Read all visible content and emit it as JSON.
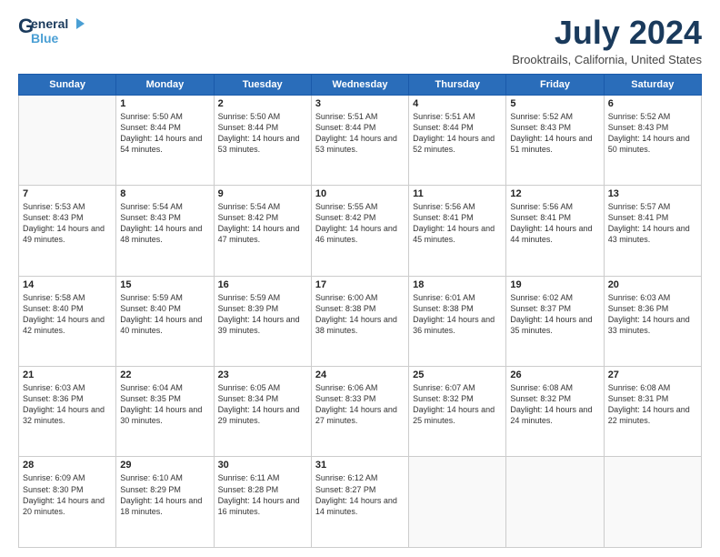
{
  "logo": {
    "g": "G",
    "eneral": "eneral",
    "blue": "Blue"
  },
  "title": "July 2024",
  "subtitle": "Brooktrails, California, United States",
  "days": [
    "Sunday",
    "Monday",
    "Tuesday",
    "Wednesday",
    "Thursday",
    "Friday",
    "Saturday"
  ],
  "weeks": [
    [
      {
        "num": "",
        "sunrise": "",
        "sunset": "",
        "daylight": ""
      },
      {
        "num": "1",
        "sunrise": "Sunrise: 5:50 AM",
        "sunset": "Sunset: 8:44 PM",
        "daylight": "Daylight: 14 hours and 54 minutes."
      },
      {
        "num": "2",
        "sunrise": "Sunrise: 5:50 AM",
        "sunset": "Sunset: 8:44 PM",
        "daylight": "Daylight: 14 hours and 53 minutes."
      },
      {
        "num": "3",
        "sunrise": "Sunrise: 5:51 AM",
        "sunset": "Sunset: 8:44 PM",
        "daylight": "Daylight: 14 hours and 53 minutes."
      },
      {
        "num": "4",
        "sunrise": "Sunrise: 5:51 AM",
        "sunset": "Sunset: 8:44 PM",
        "daylight": "Daylight: 14 hours and 52 minutes."
      },
      {
        "num": "5",
        "sunrise": "Sunrise: 5:52 AM",
        "sunset": "Sunset: 8:43 PM",
        "daylight": "Daylight: 14 hours and 51 minutes."
      },
      {
        "num": "6",
        "sunrise": "Sunrise: 5:52 AM",
        "sunset": "Sunset: 8:43 PM",
        "daylight": "Daylight: 14 hours and 50 minutes."
      }
    ],
    [
      {
        "num": "7",
        "sunrise": "Sunrise: 5:53 AM",
        "sunset": "Sunset: 8:43 PM",
        "daylight": "Daylight: 14 hours and 49 minutes."
      },
      {
        "num": "8",
        "sunrise": "Sunrise: 5:54 AM",
        "sunset": "Sunset: 8:43 PM",
        "daylight": "Daylight: 14 hours and 48 minutes."
      },
      {
        "num": "9",
        "sunrise": "Sunrise: 5:54 AM",
        "sunset": "Sunset: 8:42 PM",
        "daylight": "Daylight: 14 hours and 47 minutes."
      },
      {
        "num": "10",
        "sunrise": "Sunrise: 5:55 AM",
        "sunset": "Sunset: 8:42 PM",
        "daylight": "Daylight: 14 hours and 46 minutes."
      },
      {
        "num": "11",
        "sunrise": "Sunrise: 5:56 AM",
        "sunset": "Sunset: 8:41 PM",
        "daylight": "Daylight: 14 hours and 45 minutes."
      },
      {
        "num": "12",
        "sunrise": "Sunrise: 5:56 AM",
        "sunset": "Sunset: 8:41 PM",
        "daylight": "Daylight: 14 hours and 44 minutes."
      },
      {
        "num": "13",
        "sunrise": "Sunrise: 5:57 AM",
        "sunset": "Sunset: 8:41 PM",
        "daylight": "Daylight: 14 hours and 43 minutes."
      }
    ],
    [
      {
        "num": "14",
        "sunrise": "Sunrise: 5:58 AM",
        "sunset": "Sunset: 8:40 PM",
        "daylight": "Daylight: 14 hours and 42 minutes."
      },
      {
        "num": "15",
        "sunrise": "Sunrise: 5:59 AM",
        "sunset": "Sunset: 8:40 PM",
        "daylight": "Daylight: 14 hours and 40 minutes."
      },
      {
        "num": "16",
        "sunrise": "Sunrise: 5:59 AM",
        "sunset": "Sunset: 8:39 PM",
        "daylight": "Daylight: 14 hours and 39 minutes."
      },
      {
        "num": "17",
        "sunrise": "Sunrise: 6:00 AM",
        "sunset": "Sunset: 8:38 PM",
        "daylight": "Daylight: 14 hours and 38 minutes."
      },
      {
        "num": "18",
        "sunrise": "Sunrise: 6:01 AM",
        "sunset": "Sunset: 8:38 PM",
        "daylight": "Daylight: 14 hours and 36 minutes."
      },
      {
        "num": "19",
        "sunrise": "Sunrise: 6:02 AM",
        "sunset": "Sunset: 8:37 PM",
        "daylight": "Daylight: 14 hours and 35 minutes."
      },
      {
        "num": "20",
        "sunrise": "Sunrise: 6:03 AM",
        "sunset": "Sunset: 8:36 PM",
        "daylight": "Daylight: 14 hours and 33 minutes."
      }
    ],
    [
      {
        "num": "21",
        "sunrise": "Sunrise: 6:03 AM",
        "sunset": "Sunset: 8:36 PM",
        "daylight": "Daylight: 14 hours and 32 minutes."
      },
      {
        "num": "22",
        "sunrise": "Sunrise: 6:04 AM",
        "sunset": "Sunset: 8:35 PM",
        "daylight": "Daylight: 14 hours and 30 minutes."
      },
      {
        "num": "23",
        "sunrise": "Sunrise: 6:05 AM",
        "sunset": "Sunset: 8:34 PM",
        "daylight": "Daylight: 14 hours and 29 minutes."
      },
      {
        "num": "24",
        "sunrise": "Sunrise: 6:06 AM",
        "sunset": "Sunset: 8:33 PM",
        "daylight": "Daylight: 14 hours and 27 minutes."
      },
      {
        "num": "25",
        "sunrise": "Sunrise: 6:07 AM",
        "sunset": "Sunset: 8:32 PM",
        "daylight": "Daylight: 14 hours and 25 minutes."
      },
      {
        "num": "26",
        "sunrise": "Sunrise: 6:08 AM",
        "sunset": "Sunset: 8:32 PM",
        "daylight": "Daylight: 14 hours and 24 minutes."
      },
      {
        "num": "27",
        "sunrise": "Sunrise: 6:08 AM",
        "sunset": "Sunset: 8:31 PM",
        "daylight": "Daylight: 14 hours and 22 minutes."
      }
    ],
    [
      {
        "num": "28",
        "sunrise": "Sunrise: 6:09 AM",
        "sunset": "Sunset: 8:30 PM",
        "daylight": "Daylight: 14 hours and 20 minutes."
      },
      {
        "num": "29",
        "sunrise": "Sunrise: 6:10 AM",
        "sunset": "Sunset: 8:29 PM",
        "daylight": "Daylight: 14 hours and 18 minutes."
      },
      {
        "num": "30",
        "sunrise": "Sunrise: 6:11 AM",
        "sunset": "Sunset: 8:28 PM",
        "daylight": "Daylight: 14 hours and 16 minutes."
      },
      {
        "num": "31",
        "sunrise": "Sunrise: 6:12 AM",
        "sunset": "Sunset: 8:27 PM",
        "daylight": "Daylight: 14 hours and 14 minutes."
      },
      {
        "num": "",
        "sunrise": "",
        "sunset": "",
        "daylight": ""
      },
      {
        "num": "",
        "sunrise": "",
        "sunset": "",
        "daylight": ""
      },
      {
        "num": "",
        "sunrise": "",
        "sunset": "",
        "daylight": ""
      }
    ]
  ]
}
